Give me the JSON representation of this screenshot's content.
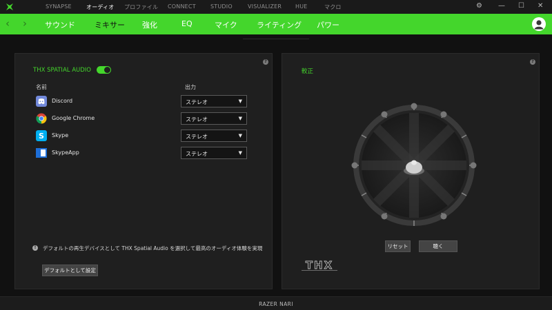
{
  "titlebar": {
    "tabs": [
      {
        "label": "SYNAPSE",
        "active": false
      },
      {
        "label": "オーディオ",
        "active": true
      },
      {
        "label": "プロファイル",
        "active": false
      },
      {
        "label": "CONNECT",
        "active": false
      },
      {
        "label": "STUDIO",
        "active": false
      },
      {
        "label": "VISUALIZER",
        "active": false
      },
      {
        "label": "HUE",
        "active": false
      },
      {
        "label": "マクロ",
        "active": false
      }
    ],
    "window_buttons": {
      "settings": "⚙",
      "minimize": "—",
      "maximize": "☐",
      "close": "✕"
    }
  },
  "subnav": {
    "back": "‹",
    "forward": "›",
    "tabs": [
      {
        "label": "サウンド",
        "active": false
      },
      {
        "label": "ミキサー",
        "active": true
      },
      {
        "label": "強化",
        "active": false
      },
      {
        "label": "EQ",
        "active": false
      },
      {
        "label": "マイク",
        "active": false
      },
      {
        "label": "ライティング",
        "active": false
      },
      {
        "label": "パワー",
        "active": false
      }
    ]
  },
  "mixer_panel": {
    "title": "THX SPATIAL AUDIO",
    "toggle_on": true,
    "help": "?",
    "col_name": "名前",
    "col_output": "出力",
    "apps": [
      {
        "name": "Discord",
        "icon": "discord-icon",
        "output": "ステレオ"
      },
      {
        "name": "Google Chrome",
        "icon": "chrome-icon",
        "output": "ステレオ"
      },
      {
        "name": "Skype",
        "icon": "skype-icon",
        "output": "ステレオ"
      },
      {
        "name": "SkypeApp",
        "icon": "skypeapp-icon",
        "output": "ステレオ"
      }
    ],
    "info_icon": "!",
    "info_text": "デフォルトの再生デバイスとして THX Spatial Audio を選択して最高のオーディオ体験を実現",
    "set_default_button": "デフォルトとして設定"
  },
  "calibration_panel": {
    "title": "較正",
    "help": "?",
    "reset_button": "リセット",
    "listen_button": "聴く",
    "logo_text": "THX"
  },
  "footer": {
    "device": "RAZER NARI"
  },
  "colors": {
    "accent": "#44d62c",
    "panel": "#1f1f1f",
    "background": "#111111"
  }
}
